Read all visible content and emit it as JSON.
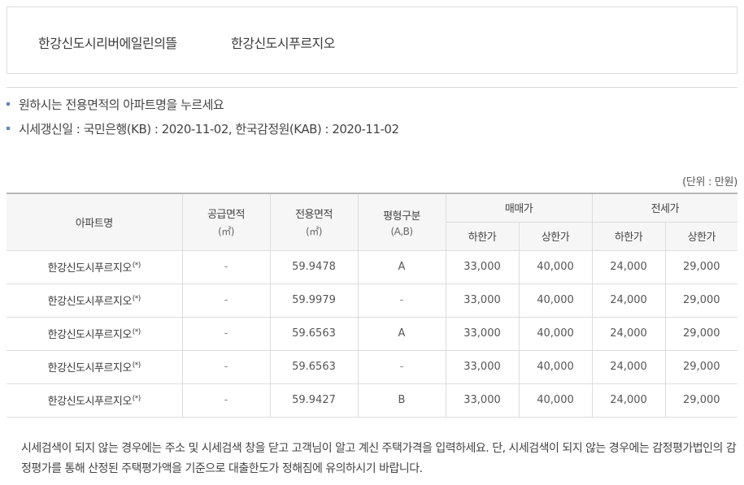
{
  "apartments": [
    {
      "label": "한강신도시리버에일린의뜰"
    },
    {
      "label": "한강신도시푸르지오"
    }
  ],
  "notes": [
    "원하시는 전용면적의 아파트명을 누르세요",
    "시세갱신일 : 국민은행(KB) : 2020-11-02, 한국감정원(KAB) : 2020-11-02"
  ],
  "unit_label": "(단위 : 만원)",
  "table": {
    "headers": {
      "apartment": "아파트명",
      "supply_area": "공급면적",
      "supply_area_unit": "(㎡)",
      "exclusive_area": "전용면적",
      "exclusive_area_unit": "(㎡)",
      "type": "평형구분",
      "type_sub": "(A,B)",
      "sale": "매매가",
      "jeonse": "전세가",
      "low": "하한가",
      "high": "상한가"
    },
    "rows": [
      {
        "name": "한강신도시푸르지오",
        "mark": "(*)",
        "supply": "-",
        "exclusive": "59.9478",
        "type": "A",
        "sale_low": "33,000",
        "sale_high": "40,000",
        "jeonse_low": "24,000",
        "jeonse_high": "29,000"
      },
      {
        "name": "한강신도시푸르지오",
        "mark": "(*)",
        "supply": "-",
        "exclusive": "59.9979",
        "type": "-",
        "sale_low": "33,000",
        "sale_high": "40,000",
        "jeonse_low": "24,000",
        "jeonse_high": "29,000"
      },
      {
        "name": "한강신도시푸르지오",
        "mark": "(*)",
        "supply": "-",
        "exclusive": "59.6563",
        "type": "A",
        "sale_low": "33,000",
        "sale_high": "40,000",
        "jeonse_low": "24,000",
        "jeonse_high": "29,000"
      },
      {
        "name": "한강신도시푸르지오",
        "mark": "(*)",
        "supply": "-",
        "exclusive": "59.6563",
        "type": "-",
        "sale_low": "33,000",
        "sale_high": "40,000",
        "jeonse_low": "24,000",
        "jeonse_high": "29,000"
      },
      {
        "name": "한강신도시푸르지오",
        "mark": "(*)",
        "supply": "-",
        "exclusive": "59.9427",
        "type": "B",
        "sale_low": "33,000",
        "sale_high": "40,000",
        "jeonse_low": "24,000",
        "jeonse_high": "29,000"
      }
    ]
  },
  "footer_note": "시세검색이 되지 않는 경우에는 주소 및 시세검색 창을 닫고 고객님이 알고 계신 주택가격을 입력하세요. 단, 시세검색이 되지 않는 경우에는 감정평가법인의 감정평가를 통해 산정된 주택평가액을 기준으로 대출한도가 정해짐에 유의하시기 바랍니다.",
  "colors": {
    "bullet": "#5f86b8",
    "header_bg": "#f6f6f6",
    "border": "#dcdcdc"
  }
}
